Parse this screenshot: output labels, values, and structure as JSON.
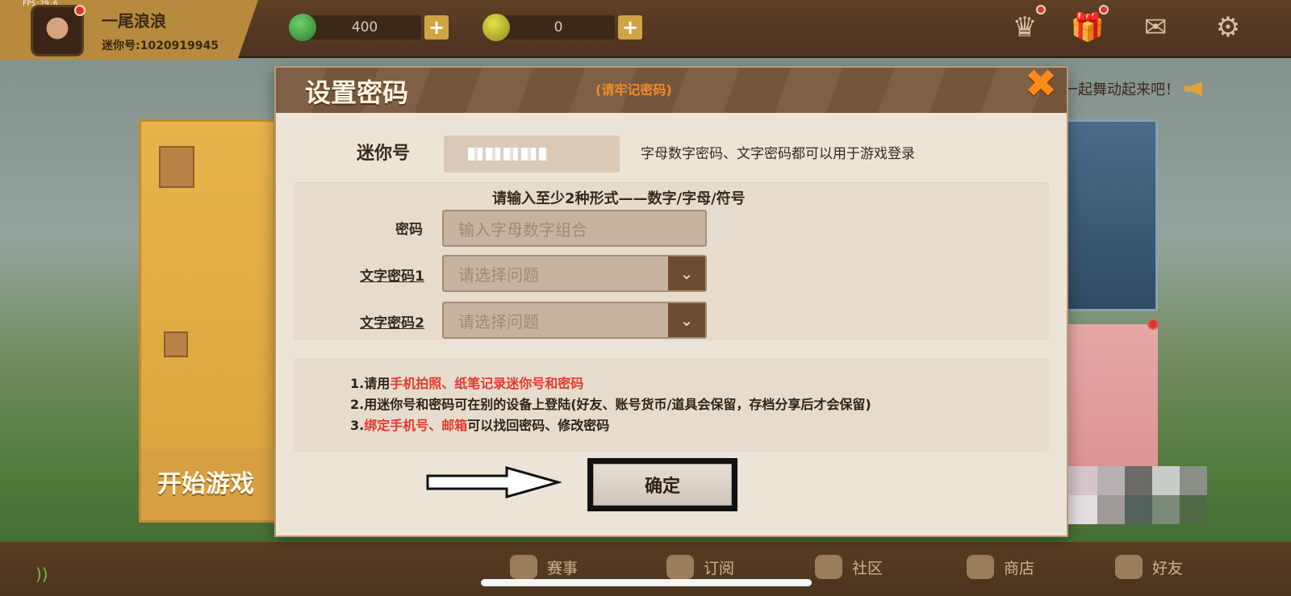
{
  "fps": "FPS:29.6",
  "profile": {
    "username": "一尾浪浪",
    "mini_id_label": "迷你号:1020919945"
  },
  "currency": [
    {
      "icon": "green-gem-icon",
      "value": "400",
      "add": "+"
    },
    {
      "icon": "gold-coin-icon",
      "value": "0",
      "add": "+"
    }
  ],
  "top_icons": [
    "crown-icon",
    "gift-icon",
    "mail-icon",
    "gear-icon"
  ],
  "background": {
    "start_game": "开始游戏",
    "marquee": "色一起舞动起来吧！"
  },
  "dialog": {
    "title": "设置密码",
    "hint": "(请牢记密码)",
    "close": "✖",
    "mini_id_label": "迷你号",
    "mini_id_note": "字母数字密码、文字密码都可以用于游戏登录",
    "instruction": "请输入至少2种形式——数字/字母/符号",
    "password_label": "密码",
    "password_placeholder": "输入字母数字组合",
    "text_pw1_label": "文字密码1",
    "text_pw1_value": "请选择问题",
    "text_pw2_label": "文字密码2",
    "text_pw2_value": "请选择问题",
    "notes": [
      {
        "prefix": "1.请用",
        "red": "手机拍照、纸笔记录迷你号和密码",
        "suffix": ""
      },
      {
        "prefix": "2.用迷你号和密码可在别的设备上登陆(好友、账号货币/道具会保留，存档分享后才会保留)",
        "red": "",
        "suffix": ""
      },
      {
        "prefix": "3.",
        "red": "绑定手机号、邮箱",
        "suffix": "可以找回密码、修改密码"
      }
    ],
    "confirm": "确定"
  },
  "bottom_nav": [
    {
      "icon": "trophy-icon",
      "label": "赛事"
    },
    {
      "icon": "star-icon",
      "label": "订阅"
    },
    {
      "icon": "community-icon",
      "label": "社区"
    },
    {
      "icon": "cart-icon",
      "label": "商店"
    },
    {
      "icon": "friends-icon",
      "label": "好友"
    }
  ]
}
